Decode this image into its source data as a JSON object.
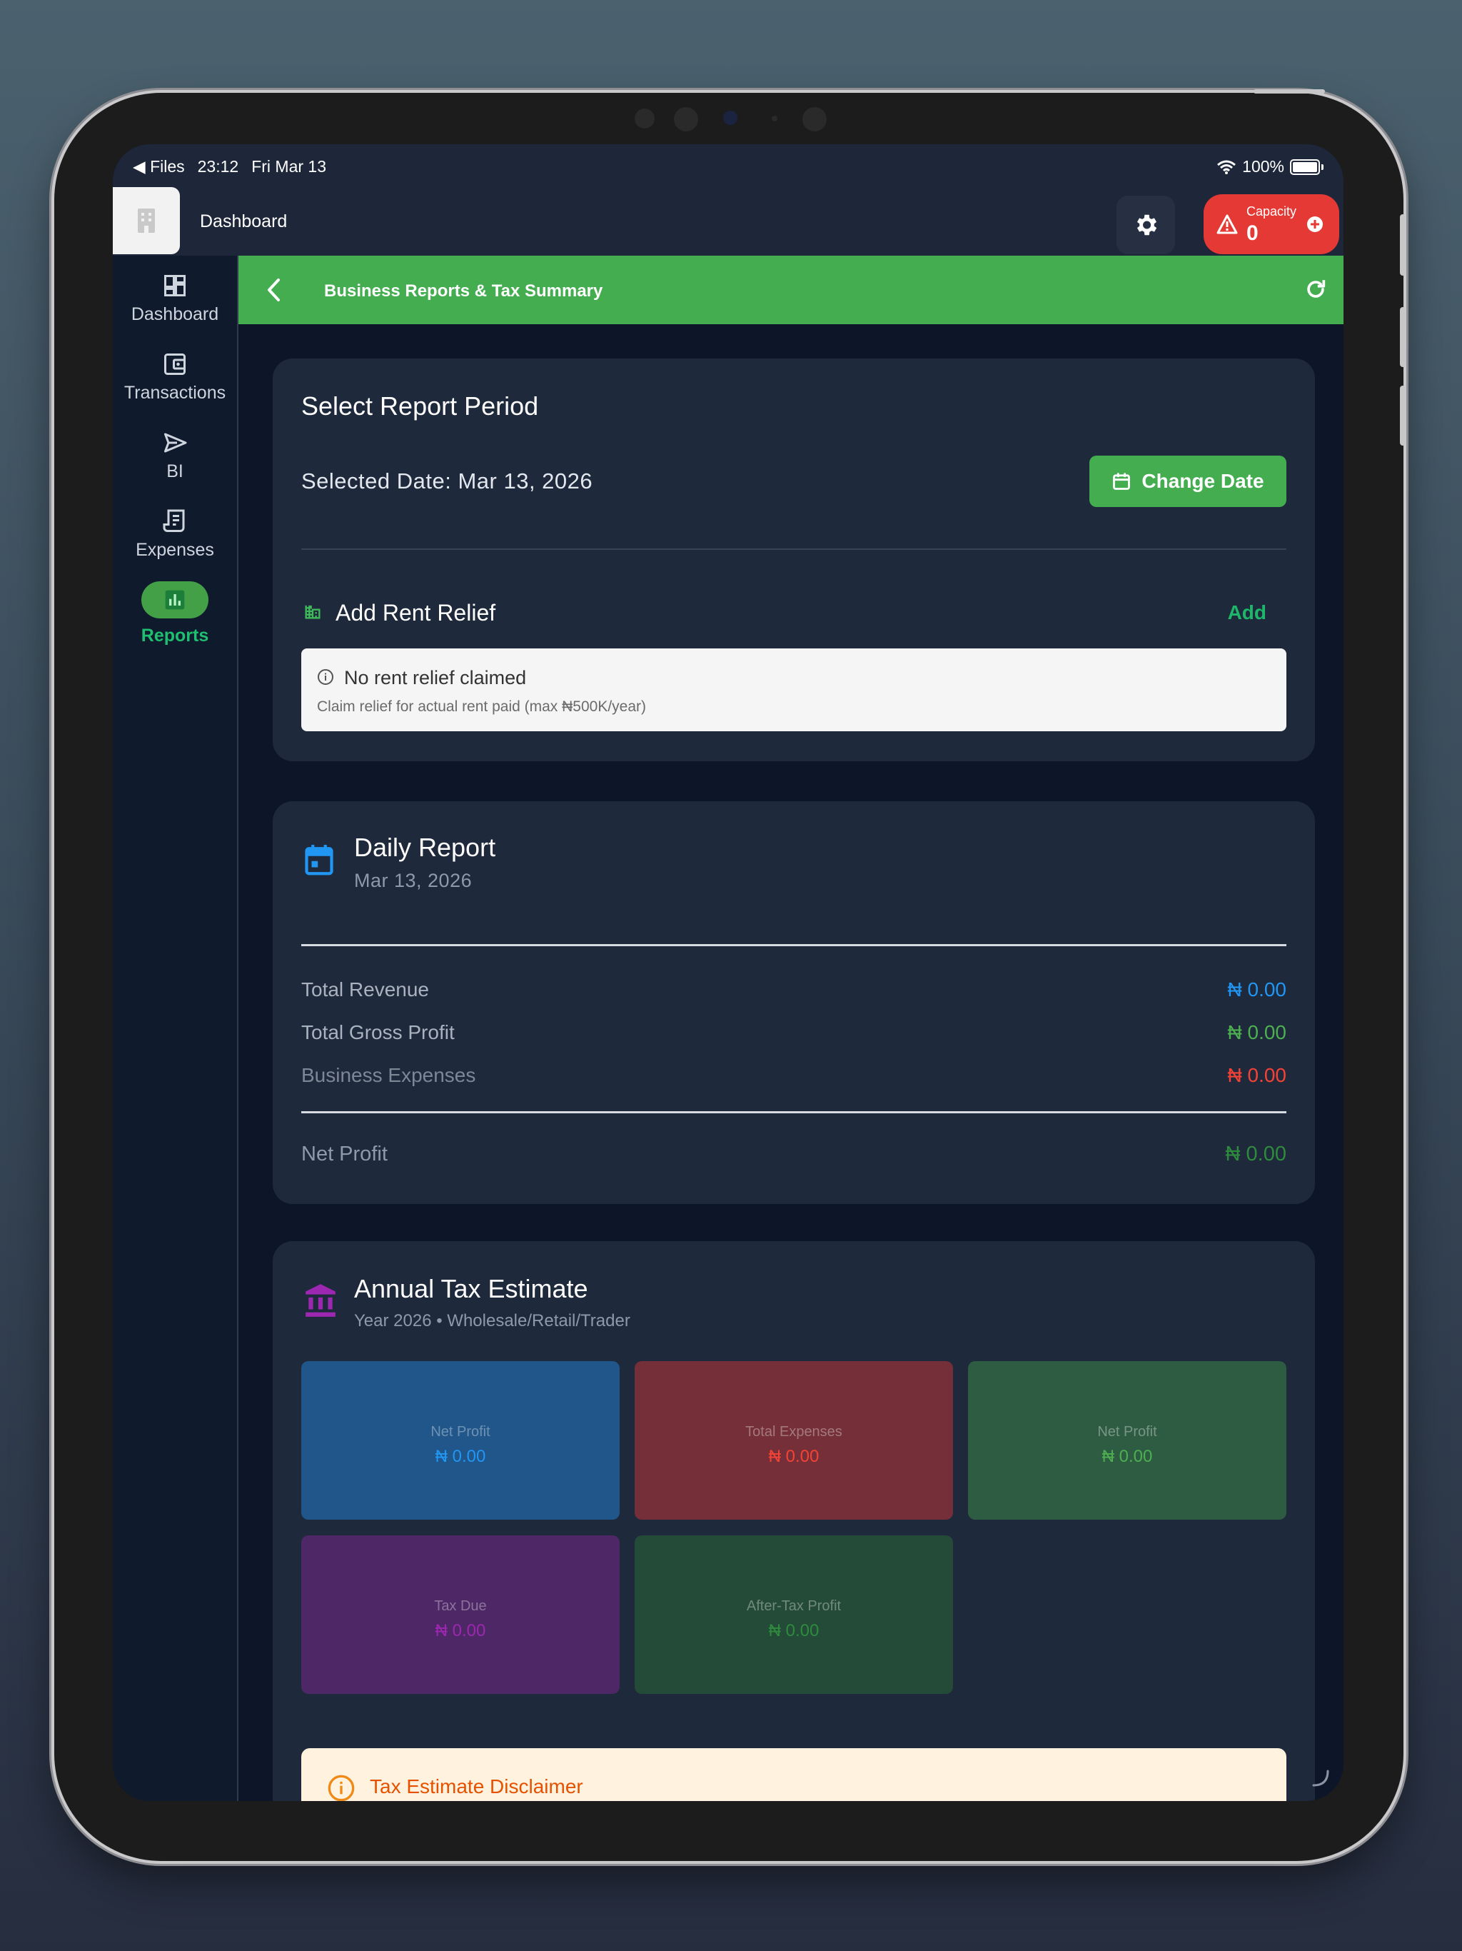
{
  "status_bar": {
    "back_app": "◀ Files",
    "time": "23:12",
    "date": "Fri Mar 13",
    "battery": "100%"
  },
  "header": {
    "title": "Dashboard",
    "capacity_label": "Capacity",
    "capacity_value": "0"
  },
  "sidebar": {
    "items": [
      {
        "label": "Dashboard",
        "icon": "dashboard-icon"
      },
      {
        "label": "Transactions",
        "icon": "wallet-icon"
      },
      {
        "label": "BI",
        "icon": "send-icon"
      },
      {
        "label": "Expenses",
        "icon": "receipt-icon"
      },
      {
        "label": "Reports",
        "icon": "bar-chart-icon",
        "active": true
      }
    ]
  },
  "page_bar": {
    "title": "Business Reports & Tax Summary"
  },
  "report_period": {
    "title": "Select Report Period",
    "selected_date": "Selected Date: Mar 13, 2026",
    "change_date_label": "Change Date",
    "rent_relief_title": "Add Rent Relief",
    "add_label": "Add",
    "no_relief_title": "No rent relief claimed",
    "no_relief_sub": "Claim relief for actual rent paid (max ₦500K/year)"
  },
  "daily_report": {
    "title": "Daily Report",
    "date": "Mar 13, 2026",
    "rows": [
      {
        "label": "Total Revenue",
        "value": "₦ 0.00"
      },
      {
        "label": "Total Gross Profit",
        "value": "₦ 0.00"
      },
      {
        "label": "Business Expenses",
        "value": "₦ 0.00"
      }
    ],
    "net_label": "Net Profit",
    "net_value": "₦ 0.00"
  },
  "annual_tax": {
    "title": "Annual Tax Estimate",
    "subtitle": "Year 2026 • Wholesale/Retail/Trader",
    "tiles": [
      {
        "label": "Net Profit",
        "value": "₦ 0.00"
      },
      {
        "label": "Total Expenses",
        "value": "₦ 0.00"
      },
      {
        "label": "Net Profit",
        "value": "₦ 0.00"
      },
      {
        "label": "Tax Due",
        "value": "₦ 0.00"
      },
      {
        "label": "After-Tax Profit",
        "value": "₦ 0.00"
      }
    ],
    "disclaimer_title": "Tax Estimate Disclaimer"
  },
  "colors": {
    "accent_green": "#43ad50",
    "danger_red": "#e53935",
    "revenue_blue": "#2196f3",
    "profit_green": "#4caf50",
    "expense_red": "#f44336",
    "tax_purple": "#9c27b0"
  }
}
